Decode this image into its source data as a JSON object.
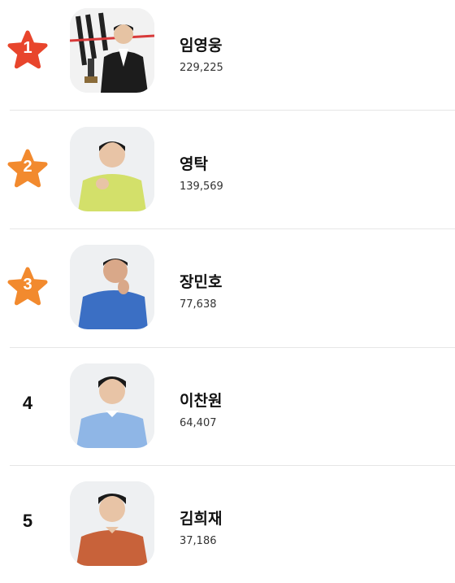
{
  "ranking": {
    "items": [
      {
        "rank": "1",
        "badge": "star",
        "badge_color": "#e8452c",
        "name": "임영웅",
        "votes": "229,225",
        "photo_icon": "person-photo",
        "photo_bg": "#f0f0f0",
        "shirt_color": "#1c1c1c"
      },
      {
        "rank": "2",
        "badge": "star",
        "badge_color": "#f28a2e",
        "name": "영탁",
        "votes": "139,569",
        "photo_icon": "person-photo",
        "photo_bg": "#eef0f2",
        "shirt_color": "#d3e06a"
      },
      {
        "rank": "3",
        "badge": "star",
        "badge_color": "#f28a2e",
        "name": "장민호",
        "votes": "77,638",
        "photo_icon": "person-photo",
        "photo_bg": "#eef0f2",
        "shirt_color": "#3b6fc4"
      },
      {
        "rank": "4",
        "badge": "plain",
        "badge_color": "#111111",
        "name": "이찬원",
        "votes": "64,407",
        "photo_icon": "person-photo",
        "photo_bg": "#eef0f2",
        "shirt_color": "#8fb6e6"
      },
      {
        "rank": "5",
        "badge": "plain",
        "badge_color": "#111111",
        "name": "김희재",
        "votes": "37,186",
        "photo_icon": "person-photo",
        "photo_bg": "#eef0f2",
        "shirt_color": "#c8623a"
      }
    ]
  }
}
